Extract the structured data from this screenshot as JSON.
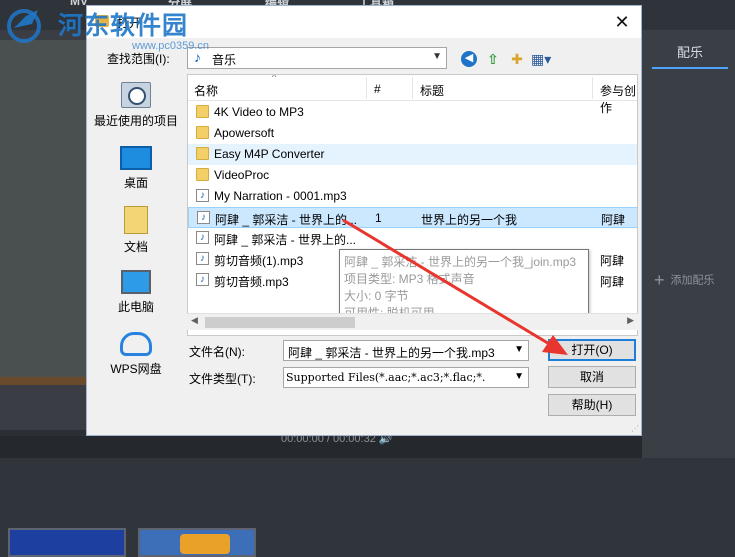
{
  "app": {
    "tab_mv": "MV",
    "tab_split": "分屏",
    "tab_edit": "编辑",
    "tab_tools": "工具箱",
    "right_tab": "配乐",
    "add_music": "添加配乐",
    "timecode": "00:00:00 / 00:00:32"
  },
  "watermark": {
    "text": "河东软件园",
    "url": "www.pc0359.cn"
  },
  "dialog": {
    "title": "打开",
    "close_glyph": "✕",
    "look_in_label": "查找范围(I):",
    "look_in_value": "音乐",
    "places": [
      {
        "label": "最近使用的项目",
        "icon": "recent-icon"
      },
      {
        "label": "桌面",
        "icon": "desktop-icon"
      },
      {
        "label": "文档",
        "icon": "documents-icon"
      },
      {
        "label": "此电脑",
        "icon": "this-pc-icon"
      },
      {
        "label": "WPS网盘",
        "icon": "wps-cloud-icon"
      }
    ],
    "columns": {
      "name": "名称",
      "num": "#",
      "title": "标题",
      "artist": "参与创作"
    },
    "files": [
      {
        "name": "4K Video to MP3",
        "kind": "folder",
        "num": "",
        "title": "",
        "artist": ""
      },
      {
        "name": "Apowersoft",
        "kind": "folder",
        "num": "",
        "title": "",
        "artist": ""
      },
      {
        "name": "Easy M4P Converter",
        "kind": "folder",
        "num": "",
        "title": "",
        "artist": ""
      },
      {
        "name": "VideoProc",
        "kind": "folder",
        "num": "",
        "title": "",
        "artist": ""
      },
      {
        "name": "My Narration - 0001.mp3",
        "kind": "audio",
        "num": "",
        "title": "",
        "artist": ""
      },
      {
        "name": "阿肆 _ 郭采洁 - 世界上的...",
        "kind": "audio",
        "num": "1",
        "title": "世界上的另一个我",
        "artist": "阿肆"
      },
      {
        "name": "阿肆 _ 郭采洁 - 世界上的...",
        "kind": "audio",
        "num": "",
        "title": "",
        "artist": ""
      },
      {
        "name": "剪切音频(1).mp3",
        "kind": "audio",
        "num": "",
        "title": "",
        "artist": "阿肆"
      },
      {
        "name": "剪切音频.mp3",
        "kind": "audio",
        "num": "",
        "title": "",
        "artist": "阿肆"
      }
    ],
    "tooltip": {
      "line1": "阿肆 _ 郭采洁 - 世界上的另一个我_join.mp3",
      "line2": "项目类型: MP3 格式声音",
      "line3": "大小: 0 字节",
      "line4": "可用性: 脱机可用"
    },
    "filename_label": "文件名(N):",
    "filename_value": "阿肆 _ 郭采洁 - 世界上的另一个我.mp3",
    "filetype_label": "文件类型(T):",
    "filetype_value": "Supported Files(*.aac;*.ac3;*.flac;*.",
    "btn_open": "打开(O)",
    "btn_cancel": "取消",
    "btn_help": "帮助(H)"
  },
  "colors": {
    "accent": "#1e7fd8",
    "arrow": "#e8352d",
    "selection": "#cce8ff"
  }
}
